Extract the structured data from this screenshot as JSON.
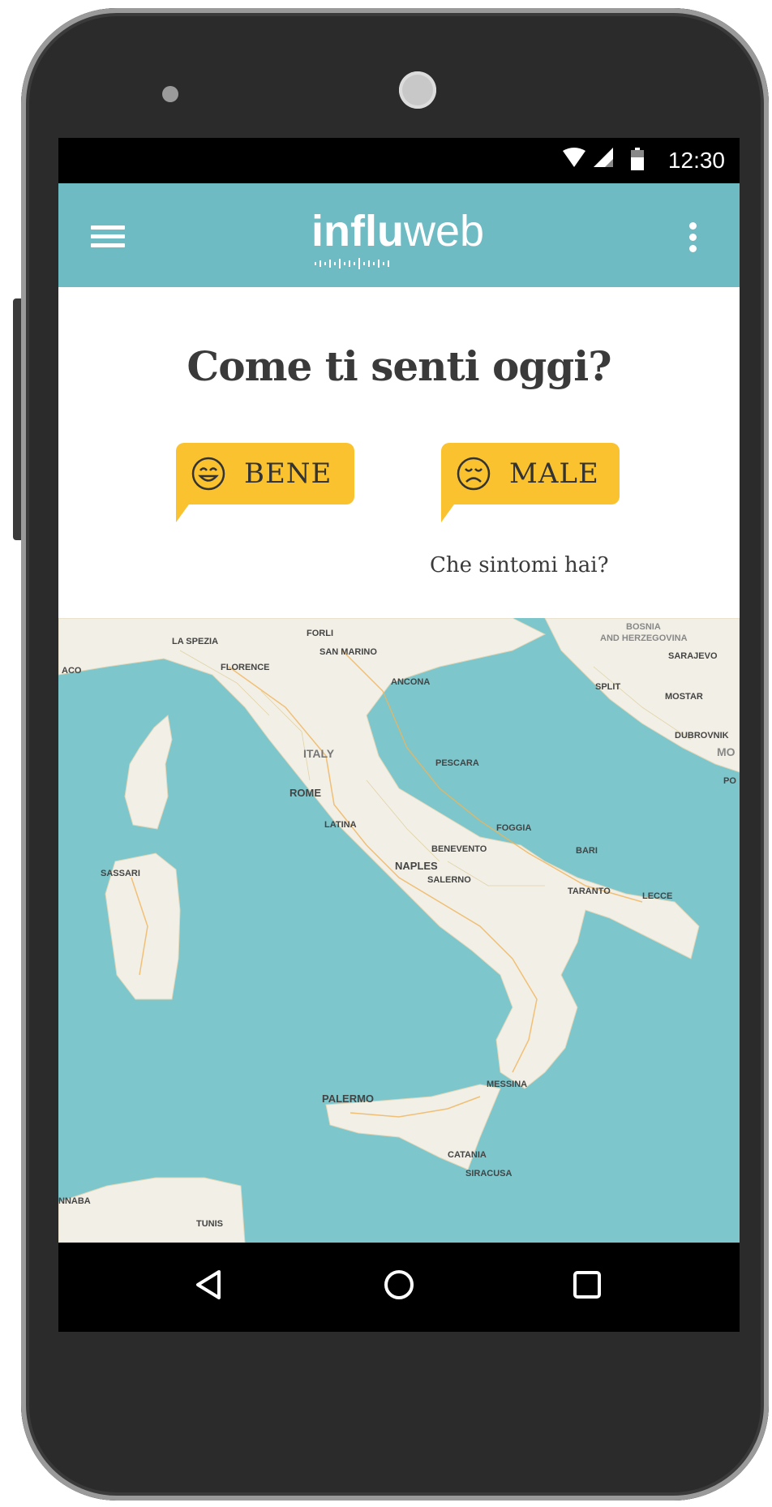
{
  "status_bar": {
    "time": "12:30",
    "icons": [
      "wifi-icon",
      "signal-icon",
      "battery-icon"
    ]
  },
  "app_bar": {
    "logo_bold": "influ",
    "logo_light": "web",
    "menu_icon": "hamburger-menu-icon",
    "overflow_icon": "more-vertical-icon",
    "background_color": "#6fbbc4"
  },
  "main": {
    "question": "Come ti senti oggi?",
    "bene_label": "BENE",
    "male_label": "MALE",
    "symptoms_link": "Che sintomi hai?",
    "bubble_color": "#f9c22e"
  },
  "map": {
    "labels": {
      "florence": "FLORENCE",
      "italy": "ITALY",
      "rome": "ROME",
      "naples": "NAPLES",
      "palermo": "PALERMO",
      "catania": "CATANIA",
      "bosnia": "BOSNIA",
      "herzegovina": "AND HERZEGOVINA",
      "sarajevo": "SARAJEVO",
      "tunis": "TUNIS",
      "foggia": "FOGGIA",
      "pescara": "PESCARA",
      "ancona": "ANCONA",
      "la_spezia": "LA SPEZIA",
      "latina": "LATINA",
      "messina": "MESSINA",
      "sassari": "SASSARI",
      "san_marino": "SAN MARINO",
      "forli": "FORLI",
      "benevento": "BENEVENTO",
      "salerno": "SALERNO",
      "bari": "BARI",
      "taranto": "TARANTO",
      "lecce": "LECCE",
      "dubrovnik": "DUBROVNIK",
      "split": "SPLIT",
      "mostar": "MOSTAR",
      "siracusa": "SIRACUSA",
      "annaba": "NNABA",
      "aco": "ACO",
      "mo": "MO",
      "po": "PO"
    },
    "sea_color": "#7cc6cc",
    "land_color": "#f2efe6"
  },
  "nav_bar": {
    "back_icon": "back-triangle-icon",
    "home_icon": "home-circle-icon",
    "recents_icon": "recents-square-icon"
  }
}
